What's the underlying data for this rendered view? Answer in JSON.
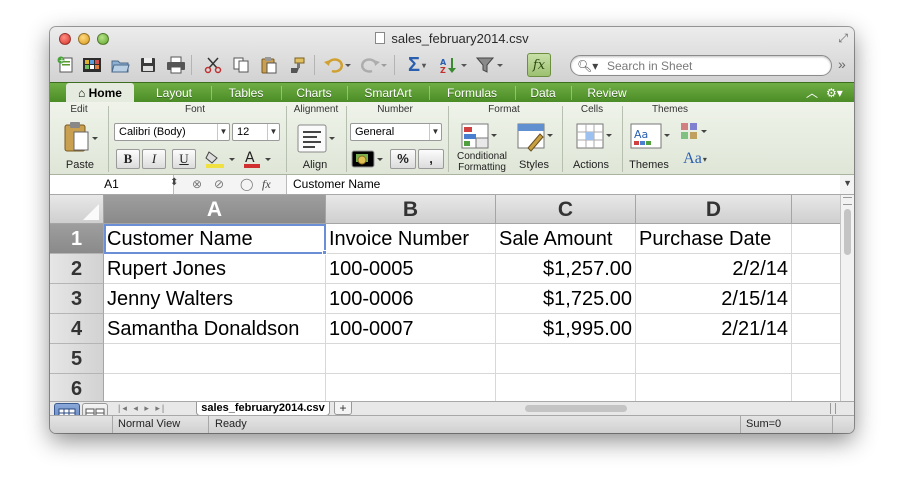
{
  "window": {
    "title": "sales_february2014.csv"
  },
  "toolbar": {
    "search_placeholder": "Search in Sheet",
    "icons": [
      "new-workbook-icon",
      "templates-icon",
      "open-icon",
      "save-icon",
      "print-icon",
      "cut-icon",
      "copy-icon",
      "paste-icon",
      "format-painter-icon",
      "undo-icon",
      "redo-icon",
      "autosum-icon",
      "sort-icon",
      "filter-icon",
      "function-icon",
      "search-icon"
    ]
  },
  "ribbon_tabs": [
    "Home",
    "Layout",
    "Tables",
    "Charts",
    "SmartArt",
    "Formulas",
    "Data",
    "Review"
  ],
  "ribbon": {
    "groups": {
      "edit": "Edit",
      "font": "Font",
      "alignment": "Alignment",
      "number": "Number",
      "format": "Format",
      "cells": "Cells",
      "themes": "Themes"
    },
    "paste_label": "Paste",
    "font_name": "Calibri (Body)",
    "font_size": "12",
    "bold": "B",
    "italic": "I",
    "underline": "U",
    "align_label": "Align",
    "number_format": "General",
    "percent": "%",
    "comma": ",",
    "conditional_formatting_line1": "Conditional",
    "conditional_formatting_line2": "Formatting",
    "styles_label": "Styles",
    "actions_label": "Actions",
    "themes_label": "Themes",
    "aa_label": "Aa"
  },
  "formula_bar": {
    "cell_ref": "A1",
    "fx": "fx",
    "content": "Customer Name"
  },
  "grid": {
    "columns": [
      "A",
      "B",
      "C",
      "D"
    ],
    "rows": [
      "1",
      "2",
      "3",
      "4",
      "5",
      "6"
    ],
    "cells": [
      [
        "Customer Name",
        "Invoice Number",
        "Sale Amount",
        "Purchase Date"
      ],
      [
        "Rupert Jones",
        "100-0005",
        "$1,257.00",
        "2/2/14"
      ],
      [
        "Jenny Walters",
        "100-0006",
        "$1,725.00",
        "2/15/14"
      ],
      [
        "Samantha Donaldson",
        "100-0007",
        "$1,995.00",
        "2/21/14"
      ],
      [
        "",
        "",
        "",
        ""
      ],
      [
        "",
        "",
        "",
        ""
      ]
    ]
  },
  "sheet_tabs": {
    "active": "sales_february2014.csv",
    "add": "+"
  },
  "status_bar": {
    "view": "Normal View",
    "state": "Ready",
    "sum": "Sum=0"
  },
  "colors": {
    "ribbon_green": "#5c9b33",
    "selection_outline": "#6b8fd6"
  }
}
